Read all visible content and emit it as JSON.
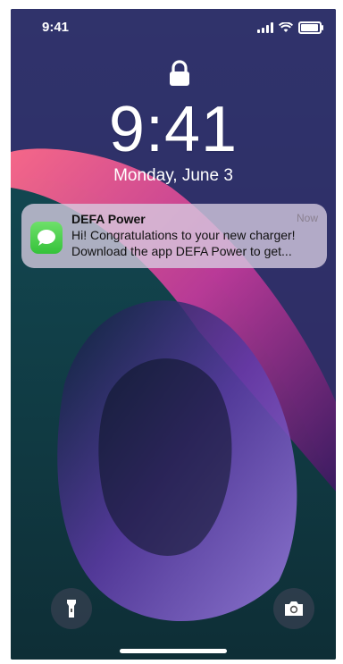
{
  "status_bar": {
    "time": "9:41",
    "signal_icon": "signal-icon",
    "wifi_icon": "wifi-icon",
    "battery_icon": "battery-icon",
    "battery_level": 0.85
  },
  "lock_screen": {
    "lock_icon": "lock-icon",
    "time": "9:41",
    "date": "Monday, June 3"
  },
  "notification": {
    "app_icon": "messages-icon",
    "app_icon_color": "#4cd34a",
    "title": "DEFA Power",
    "time": "Now",
    "body_line1": "Hi! Congratulations to your new charger!",
    "body_line2": "Download the app DEFA Power to get..."
  },
  "quick_actions": {
    "flashlight_icon": "flashlight-icon",
    "camera_icon": "camera-icon"
  }
}
